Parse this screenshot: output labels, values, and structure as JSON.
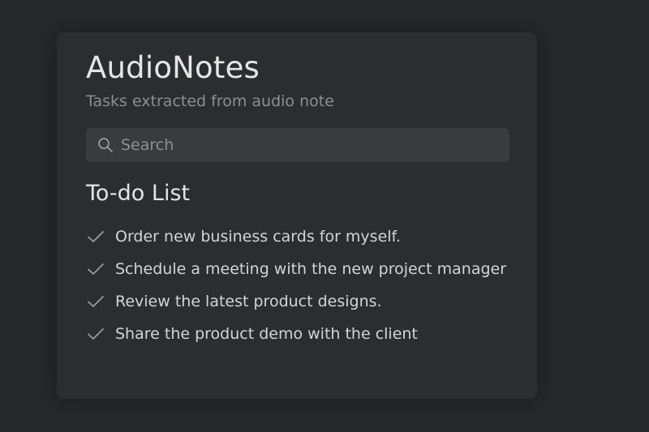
{
  "app": {
    "title": "AudioNotes",
    "subtitle": "Tasks extracted from audio note"
  },
  "search": {
    "placeholder": "Search",
    "value": "",
    "icon": "search-icon"
  },
  "todo": {
    "heading": "To-do List",
    "items": [
      {
        "label": "Order new business cards for myself.",
        "icon": "checkmark-icon"
      },
      {
        "label": "Schedule a meeting with the new project manager",
        "icon": "checkmark-icon"
      },
      {
        "label": "Review the latest product designs.",
        "icon": "checkmark-icon"
      },
      {
        "label": "Share the product demo with the client",
        "icon": "checkmark-icon"
      }
    ]
  },
  "colors": {
    "background": "#27282a",
    "card": "#2c2d2f",
    "search_field": "#3a3b3d",
    "text_primary": "#e6e6e6",
    "text_secondary": "#8d8e90",
    "checkmark": "#9a9b9d"
  }
}
